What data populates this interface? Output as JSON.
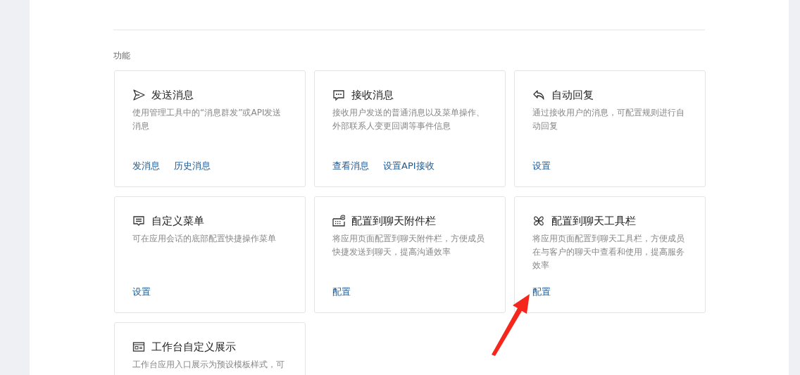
{
  "section_title": "功能",
  "cards": [
    {
      "kind": "send",
      "title": "发送消息",
      "description": "使用管理工具中的“消息群发”或API发送消息",
      "links": [
        "发消息",
        "历史消息"
      ]
    },
    {
      "kind": "chat",
      "title": "接收消息",
      "description": "接收用户发送的普通消息以及菜单操作、外部联系人变更回调等事件信息",
      "links": [
        "查看消息",
        "设置API接收"
      ]
    },
    {
      "kind": "reply",
      "title": "自动回复",
      "description": "通过接收用户的消息，可配置规则进行自动回复",
      "links": [
        "设置"
      ]
    },
    {
      "kind": "menu",
      "title": "自定义菜单",
      "description": "可在应用会话的底部配置快捷操作菜单",
      "links": [
        "设置"
      ]
    },
    {
      "kind": "attach",
      "title": "配置到聊天附件栏",
      "description": "将应用页面配置到聊天附件栏，方便成员快捷发送到聊天，提高沟通效率",
      "links": [
        "配置"
      ]
    },
    {
      "kind": "toolbar",
      "title": "配置到聊天工具栏",
      "description": "将应用页面配置到聊天工具栏，方便成员在与客户的聊天中查看和使用，提高服务效率",
      "links": [
        "配置"
      ]
    },
    {
      "kind": "card",
      "title": "工作台自定义展示",
      "description": "工作台应用入口展示为预设模板样式，可"
    }
  ]
}
